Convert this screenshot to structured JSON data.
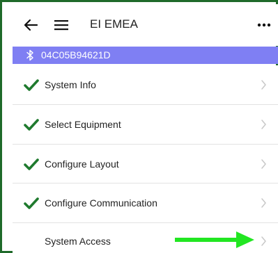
{
  "header": {
    "title": "EI EMEA",
    "back_icon": "back-arrow-icon",
    "menu_icon": "hamburger-menu-icon",
    "more_icon": "more-options-icon"
  },
  "device": {
    "icon": "bluetooth-icon",
    "id": "04C05B94621D"
  },
  "menu_items": [
    {
      "label": "System Info",
      "status": "complete"
    },
    {
      "label": "Select Equipment",
      "status": "complete"
    },
    {
      "label": "Configure Layout",
      "status": "complete"
    },
    {
      "label": "Configure Communication",
      "status": "complete"
    },
    {
      "label": "System Access",
      "status": "pending"
    }
  ],
  "colors": {
    "frame_border": "#1f6a2a",
    "device_bar": "#7f7ff3",
    "check": "#1f7a2e",
    "chevron": "#c8c8c8",
    "highlight_arrow": "#22e622"
  }
}
